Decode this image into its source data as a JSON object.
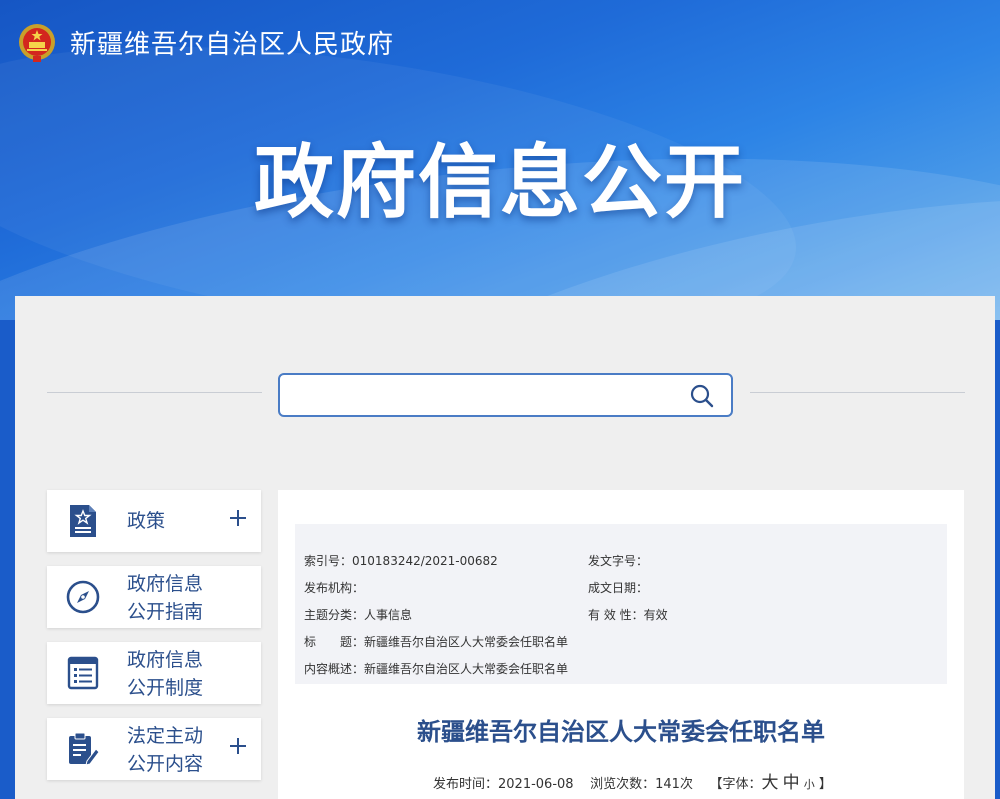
{
  "header": {
    "site_name": "新疆维吾尔自治区人民政府",
    "hero_title": "政府信息公开"
  },
  "search": {
    "placeholder": ""
  },
  "sidebar": {
    "items": [
      {
        "line1": "政策",
        "line2": "",
        "icon": "policy-doc-icon",
        "has_plus": true
      },
      {
        "line1": "政府信息",
        "line2": "公开指南",
        "icon": "compass-icon",
        "has_plus": false
      },
      {
        "line1": "政府信息",
        "line2": "公开制度",
        "icon": "list-document-icon",
        "has_plus": false
      },
      {
        "line1": "法定主动",
        "line2": "公开内容",
        "icon": "clipboard-edit-icon",
        "has_plus": true
      }
    ]
  },
  "meta": {
    "index_label": "索引号：",
    "index_value": "010183242/2021-00682",
    "doc_number_label": "发文字号：",
    "doc_number_value": "",
    "publisher_label": "发布机构：",
    "publisher_value": "",
    "created_label": "成文日期：",
    "created_value": "",
    "category_label": "主题分类：",
    "category_value": "人事信息",
    "validity_label": "有 效 性：",
    "validity_value": "有效",
    "title_label": "标　　题：",
    "title_value": "新疆维吾尔自治区人大常委会任职名单",
    "summary_label": "内容概述：",
    "summary_value": "新疆维吾尔自治区人大常委会任职名单"
  },
  "article": {
    "title": "新疆维吾尔自治区人大常委会任职名单",
    "publish_label": "发布时间：",
    "publish_date": "2021-06-08",
    "views_label": "浏览次数：",
    "views_value": "141次",
    "font_open": "【字体：",
    "font_big": "大",
    "font_mid": "中",
    "font_small": "小",
    "font_close": "】"
  },
  "colors": {
    "brand_blue": "#1a5cc9",
    "label_blue": "#2b4f8c",
    "search_border": "#4a7cc5"
  }
}
